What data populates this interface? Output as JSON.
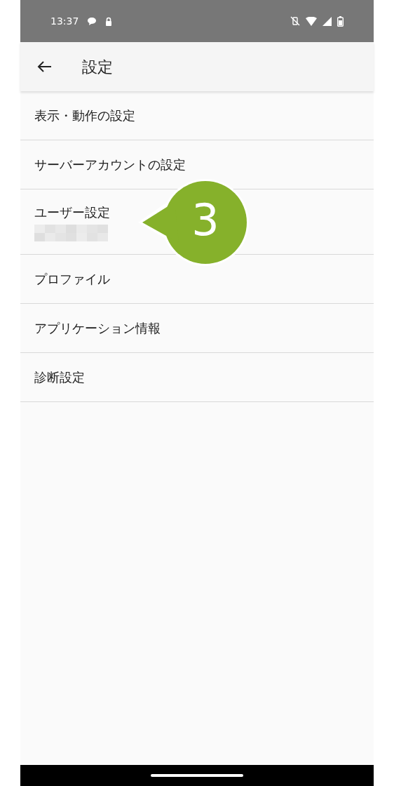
{
  "status_bar": {
    "time": "13:37"
  },
  "app_bar": {
    "title": "設定"
  },
  "items": [
    {
      "label": "表示・動作の設定",
      "redacted_detail": false
    },
    {
      "label": "サーバーアカウントの設定",
      "redacted_detail": false
    },
    {
      "label": "ユーザー設定",
      "redacted_detail": true
    },
    {
      "label": "プロファイル",
      "redacted_detail": false
    },
    {
      "label": "アプリケーション情報",
      "redacted_detail": false
    },
    {
      "label": "診断設定",
      "redacted_detail": false
    }
  ],
  "callout": {
    "number": "3"
  }
}
